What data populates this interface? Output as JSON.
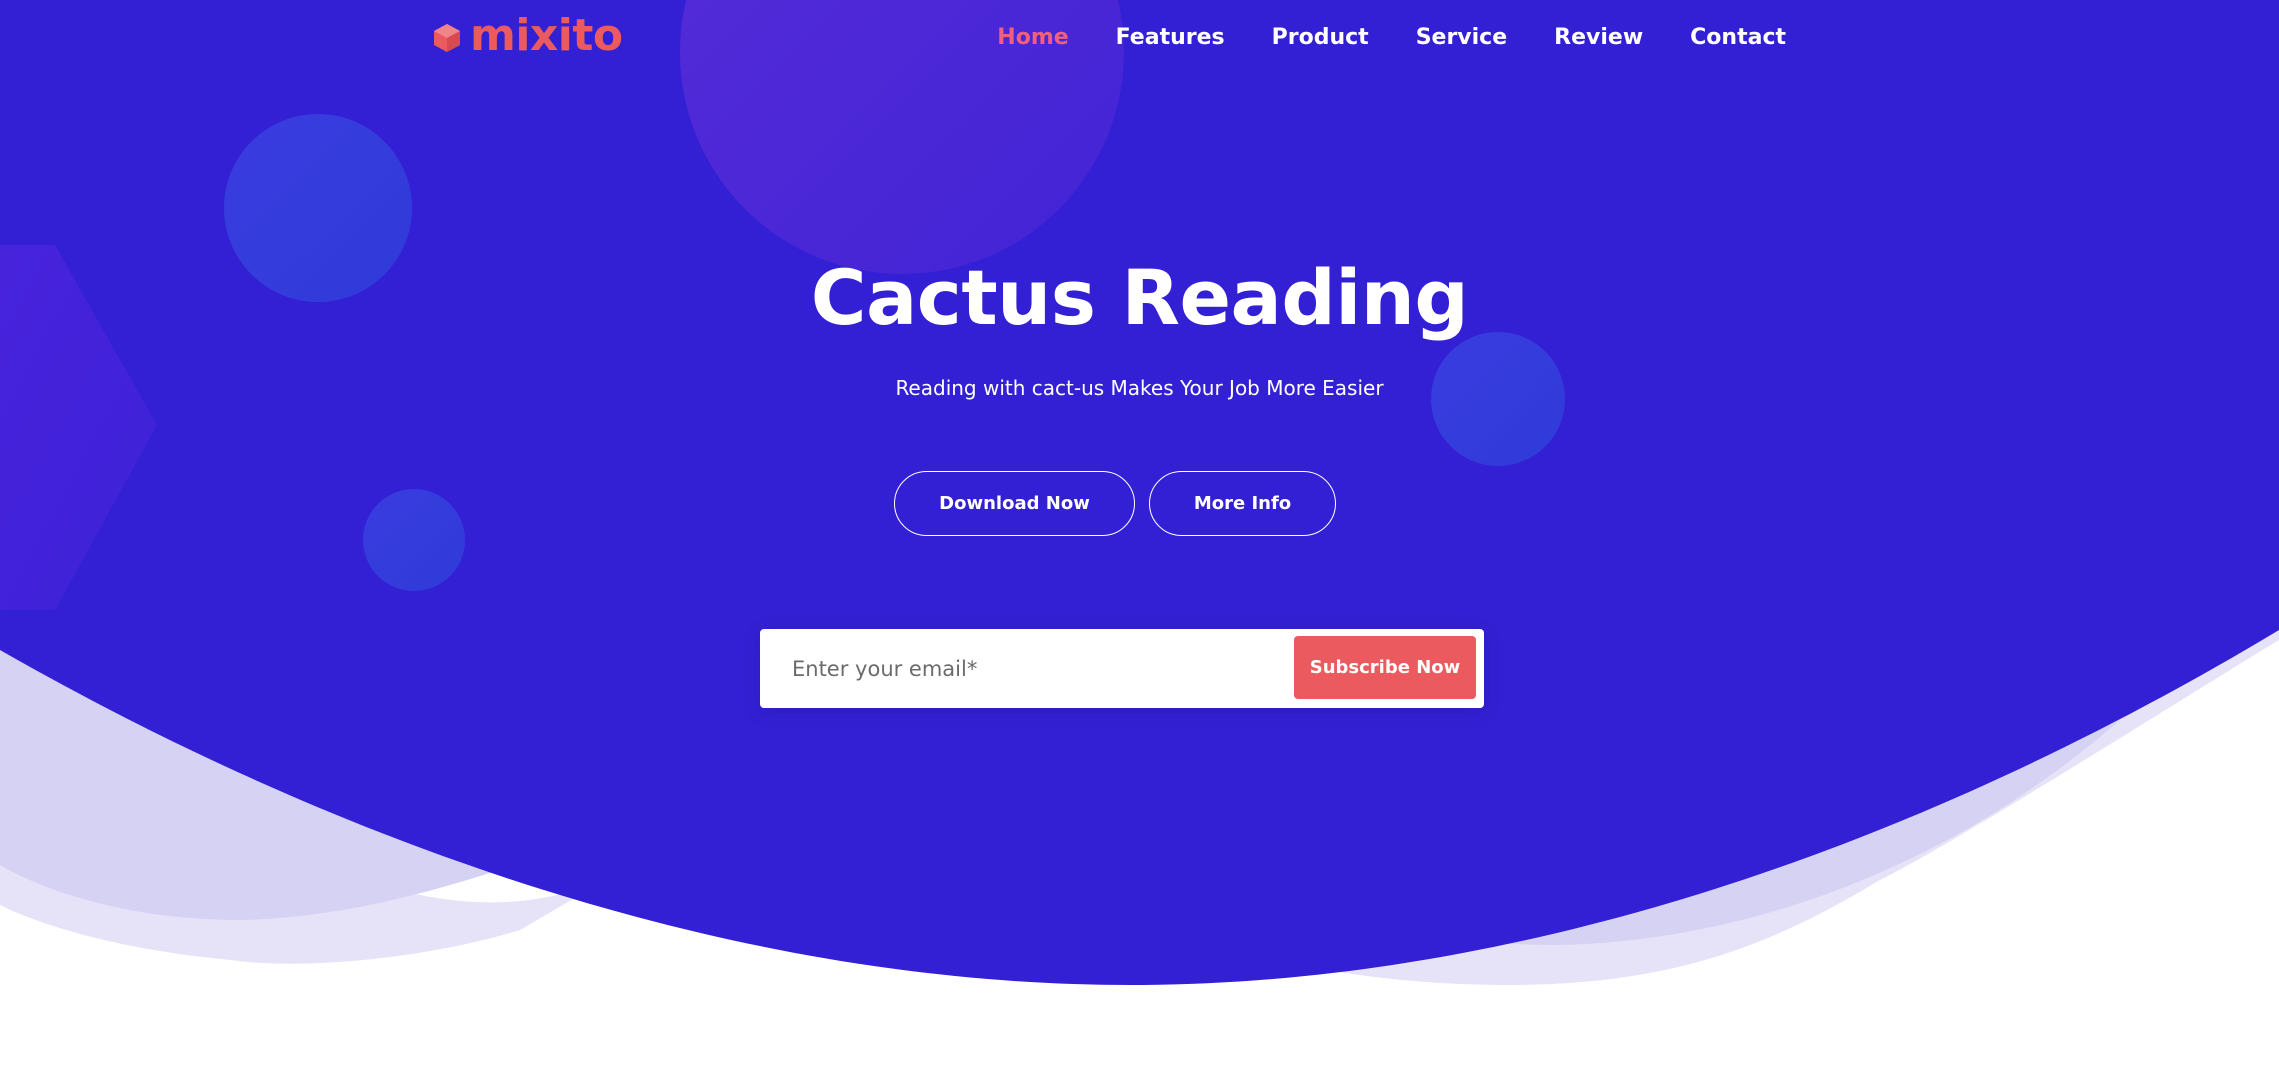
{
  "theme": {
    "primary": "#3320d4",
    "accent": "#ea5a5e",
    "nav_active": "#f0607a",
    "text_light": "#ffffff",
    "wave_light": "#e6e3f8",
    "wave_mid": "#d6d2f3"
  },
  "brand": {
    "name": "mixito",
    "icon": "cube-icon"
  },
  "nav": {
    "items": [
      {
        "label": "Home",
        "active": true
      },
      {
        "label": "Features",
        "active": false
      },
      {
        "label": "Product",
        "active": false
      },
      {
        "label": "Service",
        "active": false
      },
      {
        "label": "Review",
        "active": false
      },
      {
        "label": "Contact",
        "active": false
      }
    ]
  },
  "hero": {
    "title": "Cactus Reading",
    "subtitle": "Reading with cact-us Makes Your Job More Easier",
    "buttons": {
      "download": "Download Now",
      "more_info": "More Info"
    }
  },
  "subscribe": {
    "placeholder": "Enter your email*",
    "value": "",
    "button_label": "Subscribe Now"
  }
}
